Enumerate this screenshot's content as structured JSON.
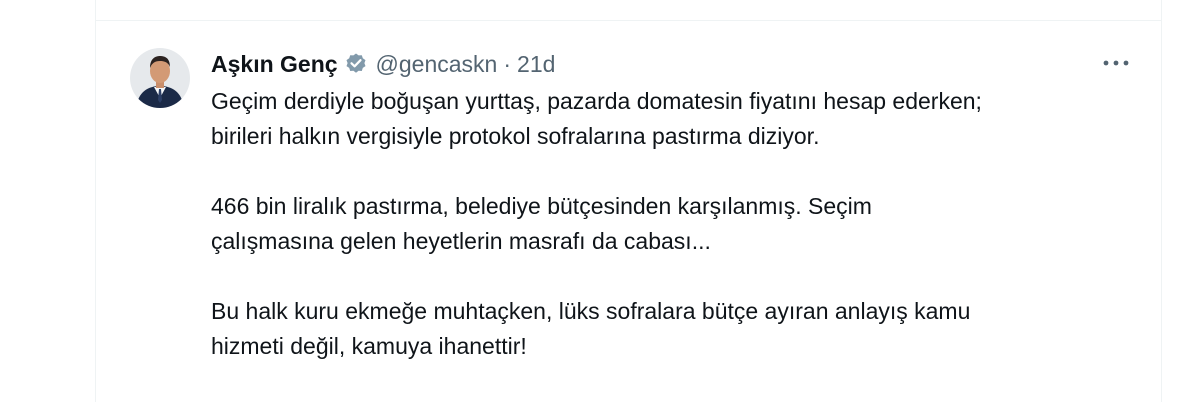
{
  "tweet": {
    "author": {
      "display_name": "Aşkın Genç",
      "handle": "@gencaskn",
      "verified": true,
      "avatar_icon": "profile-photo"
    },
    "separator": "·",
    "timestamp": "21d",
    "more_icon": "more-horizontal-icon",
    "paragraphs": [
      {
        "lines": [
          "Geçim derdiyle boğuşan yurttaş, pazarda domatesin fiyatını hesap ederken;",
          "birileri halkın vergisiyle protokol sofralarına pastırma diziyor."
        ]
      },
      {
        "lines": [
          "466 bin liralık pastırma, belediye bütçesinden karşılanmış. Seçim",
          "çalışmasına gelen heyetlerin masrafı da cabası..."
        ]
      },
      {
        "lines": [
          "Bu halk kuru ekmeğe muhtaçken, lüks sofralara bütçe ayıran anlayış kamu",
          "hizmeti değil, kamuya ihanettir!"
        ]
      }
    ]
  },
  "colors": {
    "text": "#0f1419",
    "muted": "#536471",
    "border": "#eff3f4",
    "verified_badge": "#829aab"
  }
}
